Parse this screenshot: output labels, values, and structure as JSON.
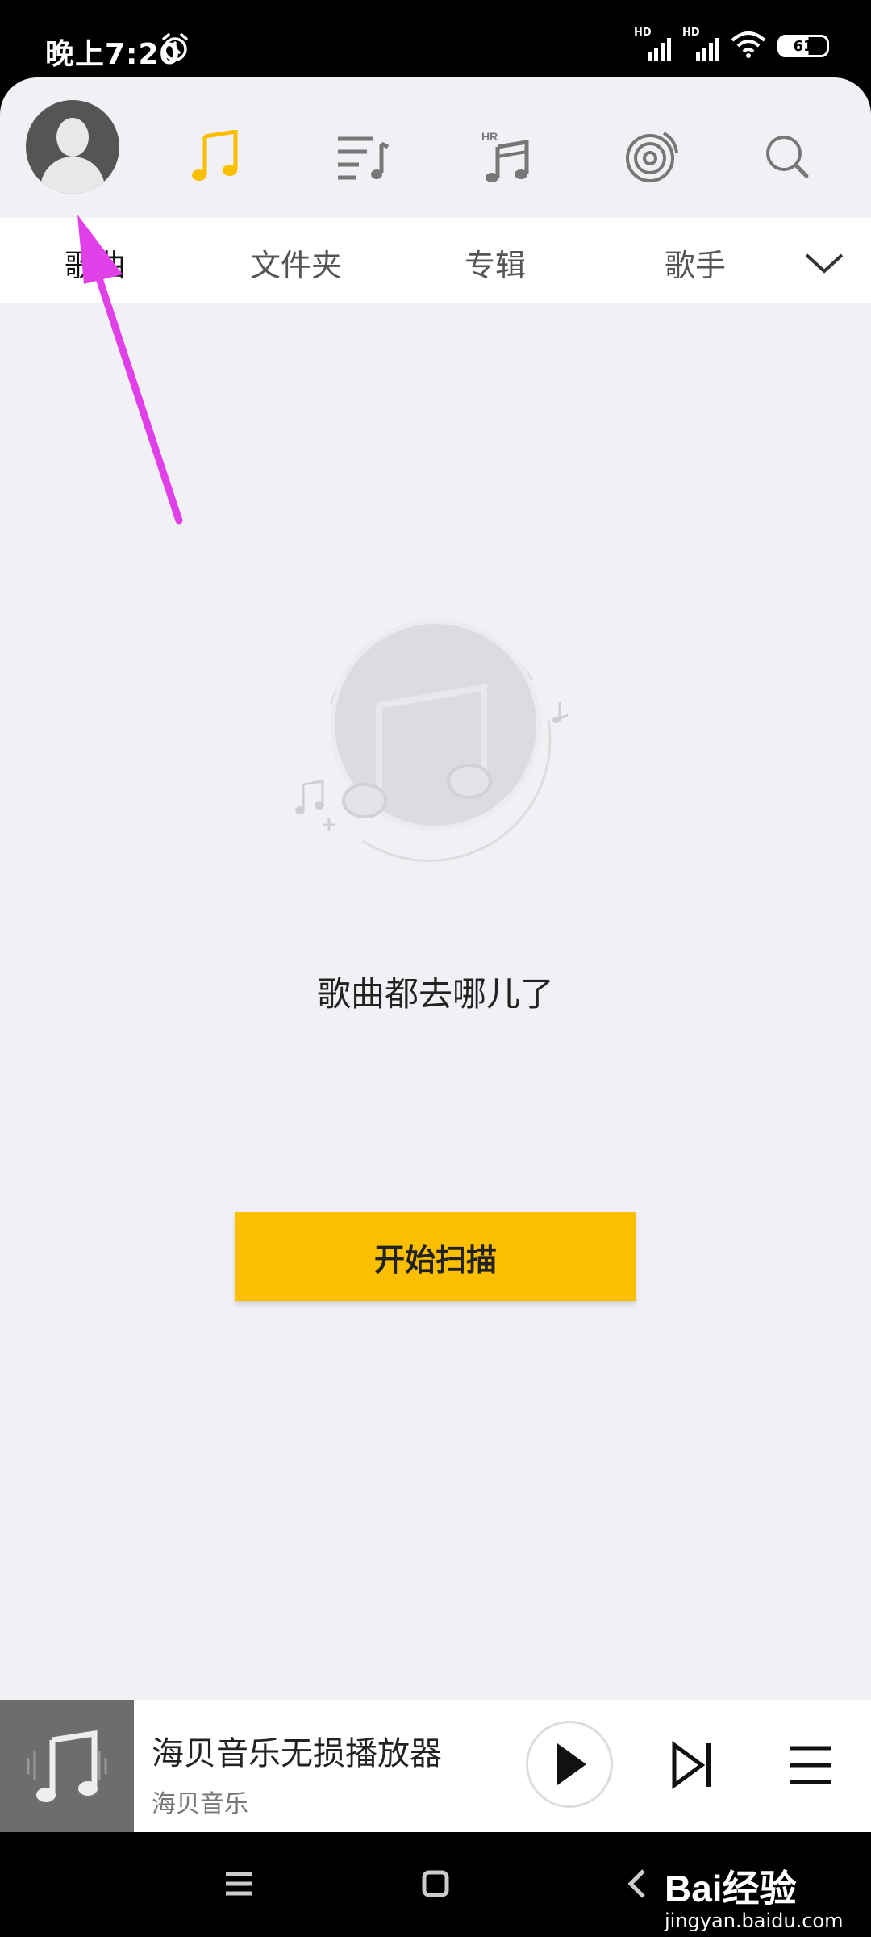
{
  "status_bar": {
    "time": "晚上7:20",
    "signal_1_label": "HD",
    "signal_2_label": "HD",
    "battery": "61"
  },
  "top_nav": {
    "icons": [
      "avatar",
      "music-note-icon",
      "playlist-icon",
      "hr-music-icon",
      "vinyl-disc-icon",
      "search-icon"
    ],
    "hr_badge": "HR",
    "active_color": "#f9bf00"
  },
  "tabs": [
    {
      "label": "歌曲",
      "active": true
    },
    {
      "label": "文件夹",
      "active": false
    },
    {
      "label": "专辑",
      "active": false
    },
    {
      "label": "歌手",
      "active": false
    }
  ],
  "empty_state": {
    "message": "歌曲都去哪儿了",
    "scan_button": "开始扫描"
  },
  "mini_player": {
    "title": "海贝音乐无损播放器",
    "artist": "海贝音乐"
  },
  "watermark": {
    "brand": "Bai经验",
    "site": "jingyan.baidu.com"
  },
  "colors": {
    "accent": "#f9bf00",
    "background": "#f1f0f5",
    "annotation": "#e040e8"
  }
}
